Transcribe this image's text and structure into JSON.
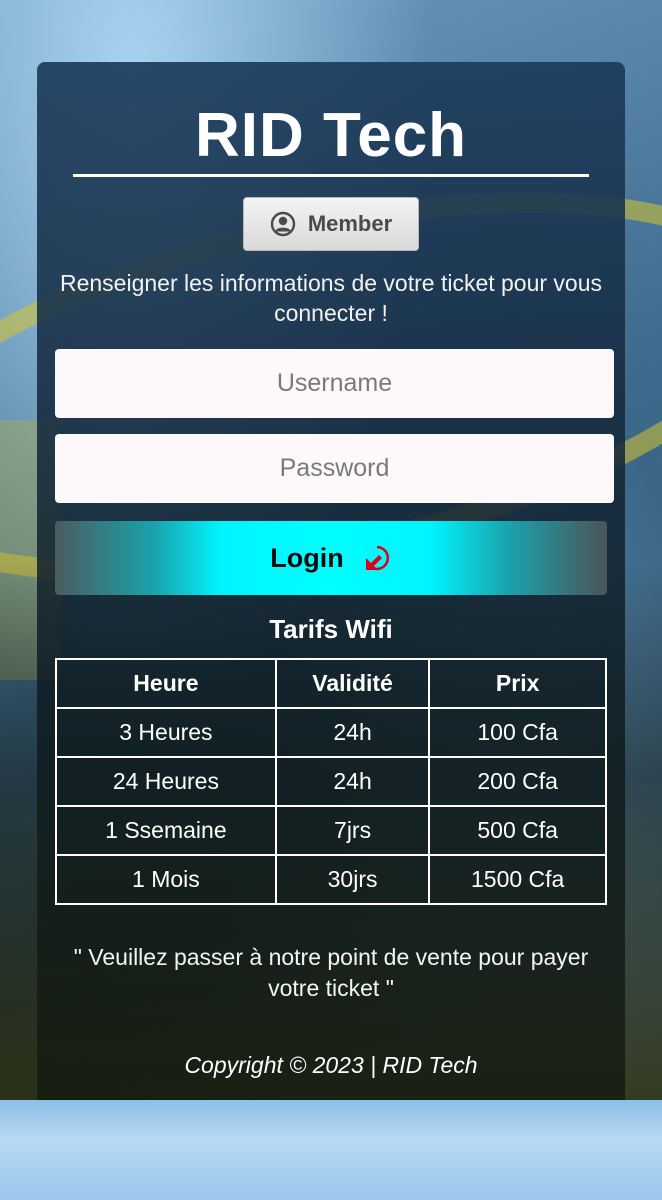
{
  "header": {
    "title": "RID Tech"
  },
  "member_button": {
    "label": "Member",
    "icon": "user-circle-icon"
  },
  "intro_text": "Renseigner les informations de votre ticket pour vous connecter !",
  "form": {
    "username_placeholder": "Username",
    "username_value": "",
    "password_placeholder": "Password",
    "password_value": ""
  },
  "login_button": {
    "label": "Login",
    "icon": "login-arrow-icon"
  },
  "tarifs": {
    "title": "Tarifs Wifi",
    "headers": [
      "Heure",
      "Validité",
      "Prix"
    ],
    "rows": [
      [
        "3 Heures",
        "24h",
        "100 Cfa"
      ],
      [
        "24 Heures",
        "24h",
        "200 Cfa"
      ],
      [
        "1 Ssemaine",
        "7jrs",
        "500 Cfa"
      ],
      [
        "1 Mois",
        "30jrs",
        "1500 Cfa"
      ]
    ]
  },
  "notice": "\" Veuillez passer à notre point de vente pour payer votre ticket \"",
  "footer": {
    "copyright": "Copyright © 2023 | RID Tech"
  },
  "colors": {
    "login_accent": "#00ffff",
    "login_icon": "#e0001b",
    "card_top": "#1c3c5c"
  }
}
